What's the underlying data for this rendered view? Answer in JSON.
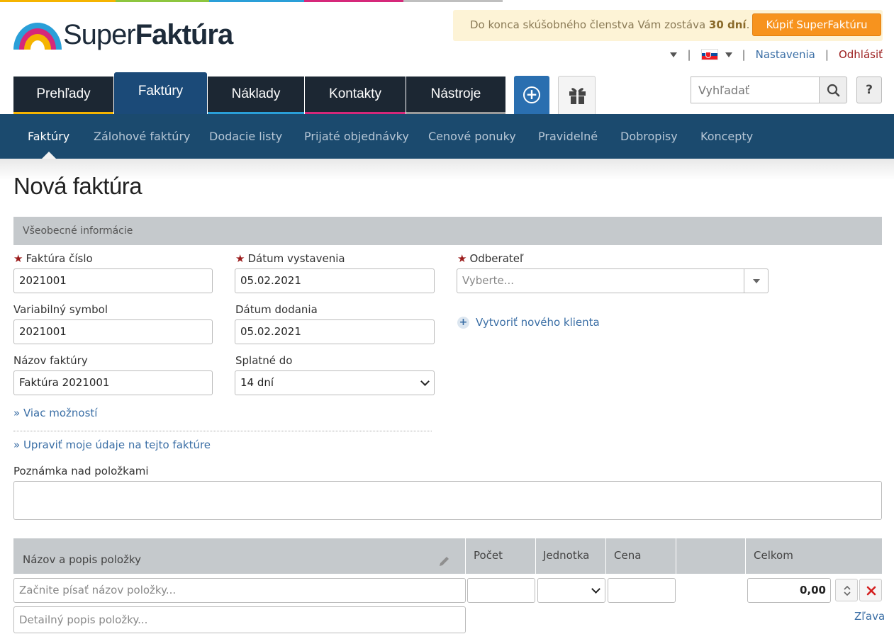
{
  "brand": {
    "name_light": "Super",
    "name_bold": "Faktúra",
    "strip_colors": [
      "#f5b400",
      "#8dc63f",
      "#2a9fd8",
      "#d6287a",
      "#9b9b9b",
      "#ffffff"
    ]
  },
  "trial": {
    "text_before": "Do konca skúšobného členstva Vám zostáva ",
    "days": "30 dní",
    "text_after": ".",
    "buy_label": "Kúpiť SuperFaktúru"
  },
  "userbar": {
    "settings": "Nastavenia",
    "logout": "Odhlásiť",
    "separator": "|"
  },
  "tabs": [
    {
      "label": "Prehľady",
      "bar_color": "#f5b400"
    },
    {
      "label": "Faktúry",
      "bar_color": "#2a9fd8"
    },
    {
      "label": "Náklady",
      "bar_color": "#2a9fd8"
    },
    {
      "label": "Kontakty",
      "bar_color": "#d6287a"
    },
    {
      "label": "Nástroje",
      "bar_color": "#9b9b9b"
    }
  ],
  "search": {
    "placeholder": "Vyhľadať"
  },
  "help_label": "?",
  "subnav": [
    "Faktúry",
    "Zálohové faktúry",
    "Dodacie listy",
    "Prijaté objednávky",
    "Cenové ponuky",
    "Pravidelné",
    "Dobropisy",
    "Koncepty"
  ],
  "page_title": "Nová faktúra",
  "section_title": "Všeobecné informácie",
  "form": {
    "invoice_number": {
      "label": "Faktúra číslo",
      "value": "2021001"
    },
    "issue_date": {
      "label": "Dátum vystavenia",
      "value": "05.02.2021"
    },
    "customer": {
      "label": "Odberateľ",
      "placeholder": "Vyberte..."
    },
    "variable_symbol": {
      "label": "Variabilný symbol",
      "value": "2021001"
    },
    "delivery_date": {
      "label": "Dátum dodania",
      "value": "05.02.2021"
    },
    "invoice_name": {
      "label": "Názov faktúry",
      "value": "Faktúra 2021001"
    },
    "due": {
      "label": "Splatné do",
      "value": "14 dní"
    },
    "more_options": "» Viac možností",
    "edit_my_data": "» Upraviť moje údaje na tejto faktúre",
    "new_client": "Vytvoriť nového klienta",
    "note_label": "Poznámka nad položkami"
  },
  "items_table": {
    "headers": {
      "name": "Názov a popis položky",
      "qty": "Počet",
      "unit": "Jednotka",
      "price": "Cena",
      "total": "Celkom"
    },
    "row": {
      "name_placeholder": "Začnite písať názov položky...",
      "desc_placeholder": "Detailný popis položky...",
      "total": "0,00",
      "discount": "Zľava"
    }
  }
}
